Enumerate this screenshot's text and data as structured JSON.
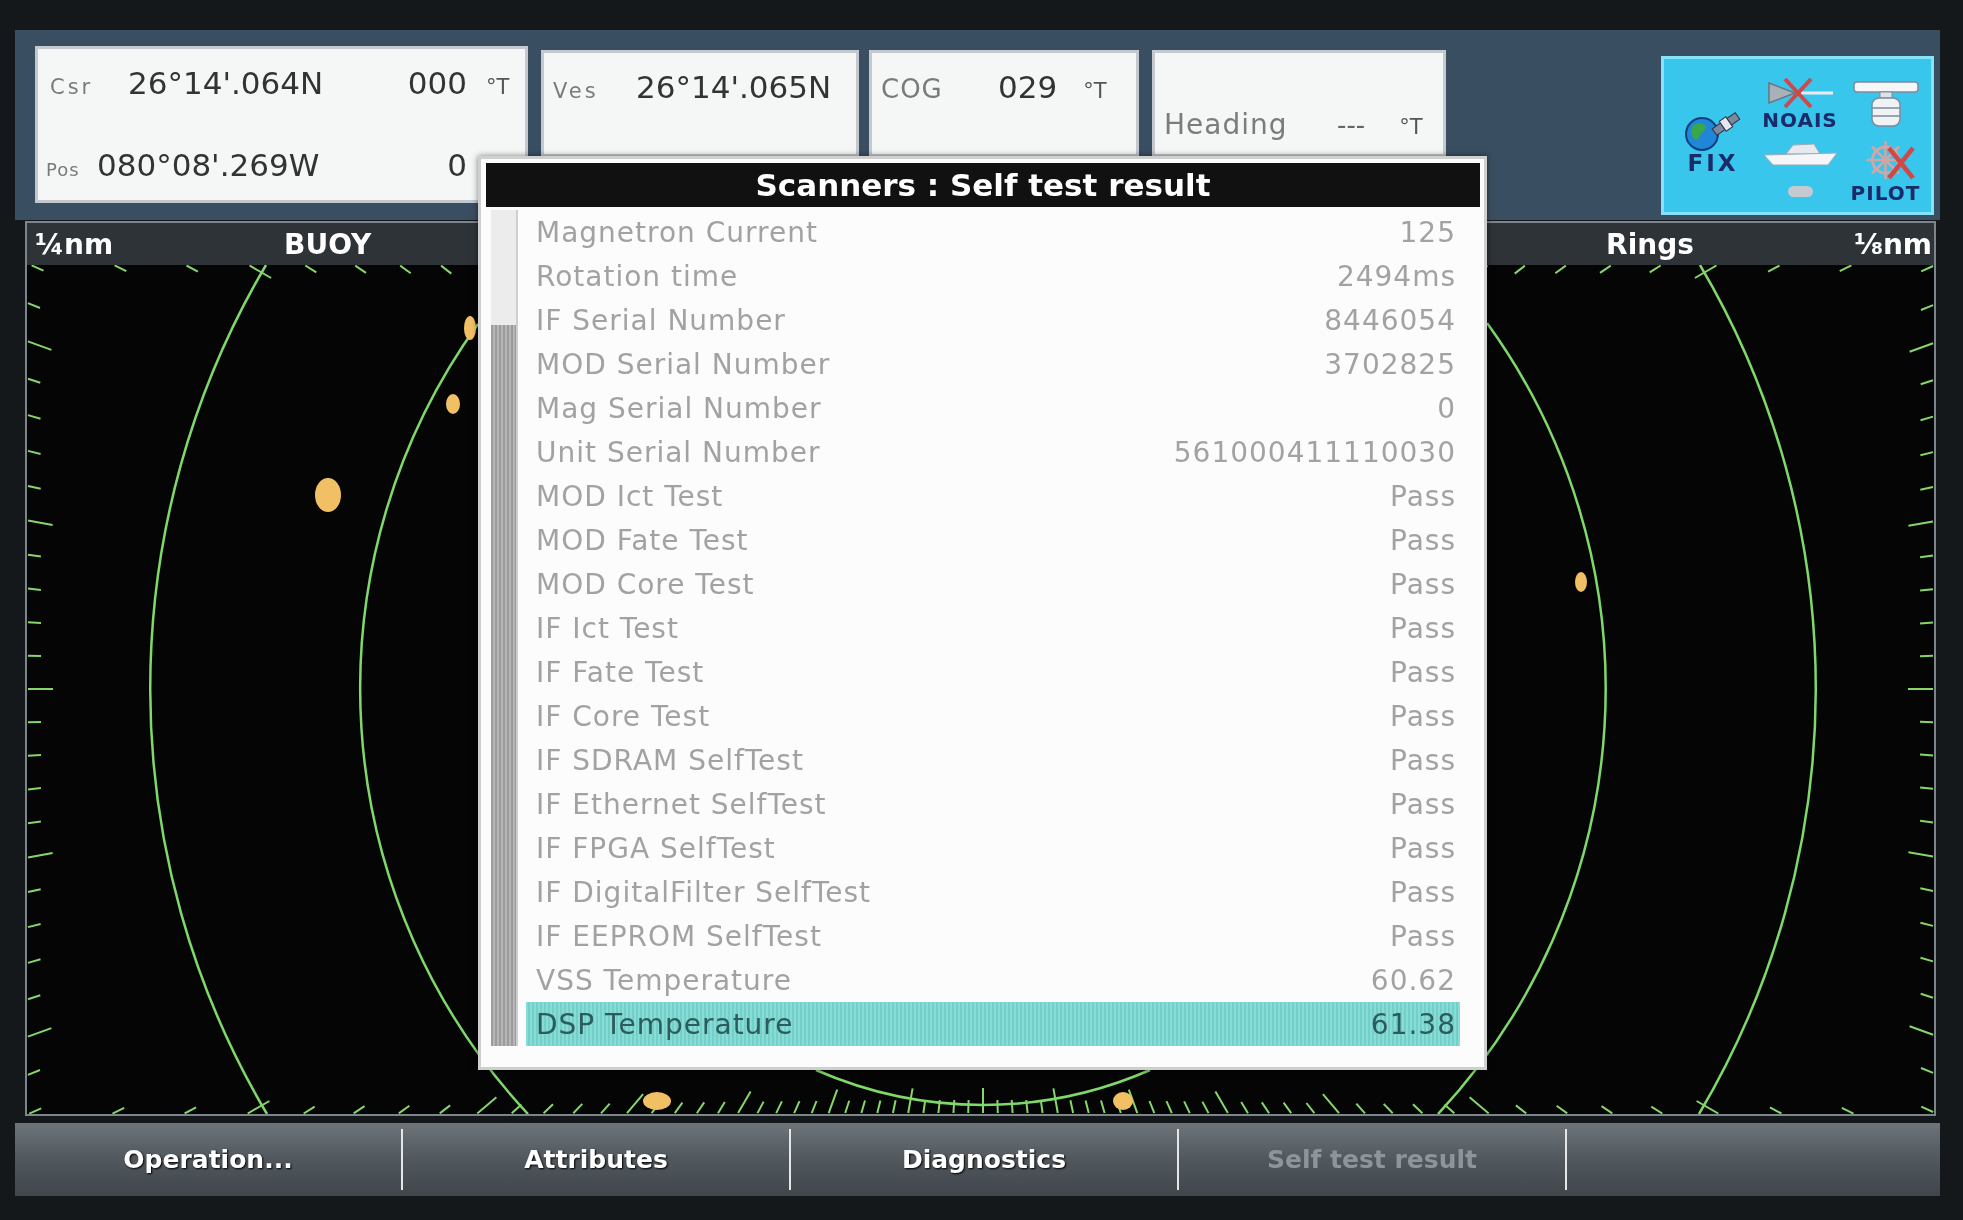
{
  "position_panel": {
    "cursor": {
      "label": "Csr",
      "latitude": "26°14'.064N",
      "bearing": "000",
      "unit": "°T"
    },
    "position": {
      "label": "Pos",
      "longitude": "080°08'.269W",
      "value": "0"
    }
  },
  "vessel_panel": {
    "label": "Ves",
    "latitude": "26°14'.065N"
  },
  "cog_panel": {
    "label": "COG",
    "value": "029",
    "unit": "°T"
  },
  "heading_panel": {
    "label": "Heading",
    "value": "---",
    "unit": "°T"
  },
  "status_panel": {
    "items": [
      {
        "kind": "satellite",
        "label": "FIX",
        "on": true
      },
      {
        "kind": "ais",
        "label": "NOAIS",
        "on": false
      },
      {
        "kind": "antenna",
        "on": true
      },
      {
        "kind": "boat",
        "on": true
      },
      {
        "kind": "capsule",
        "on": true
      },
      {
        "kind": "wheel",
        "label": "PILOT",
        "on": false
      }
    ]
  },
  "radar": {
    "range": "¼nm",
    "mode": "BUOY",
    "rings_label": "Rings",
    "rings_range": "⅛nm"
  },
  "dialog": {
    "title": "Scanners : Self test result",
    "rows": [
      {
        "label": "Magnetron Current",
        "value": "125",
        "selected": false
      },
      {
        "label": "Rotation time",
        "value": "2494ms",
        "selected": false
      },
      {
        "label": "IF Serial Number",
        "value": "8446054",
        "selected": false
      },
      {
        "label": "MOD Serial Number",
        "value": "3702825",
        "selected": false
      },
      {
        "label": "Mag Serial Number",
        "value": "0",
        "selected": false
      },
      {
        "label": "Unit Serial Number",
        "value": "561000411110030",
        "selected": false
      },
      {
        "label": "MOD Ict Test",
        "value": "Pass",
        "selected": false
      },
      {
        "label": "MOD Fate Test",
        "value": "Pass",
        "selected": false
      },
      {
        "label": "MOD Core Test",
        "value": "Pass",
        "selected": false
      },
      {
        "label": "IF Ict Test",
        "value": "Pass",
        "selected": false
      },
      {
        "label": "IF Fate Test",
        "value": "Pass",
        "selected": false
      },
      {
        "label": "IF Core Test",
        "value": "Pass",
        "selected": false
      },
      {
        "label": "IF SDRAM SelfTest",
        "value": "Pass",
        "selected": false
      },
      {
        "label": "IF Ethernet SelfTest",
        "value": "Pass",
        "selected": false
      },
      {
        "label": "IF FPGA SelfTest",
        "value": "Pass",
        "selected": false
      },
      {
        "label": "IF DigitalFilter SelfTest",
        "value": "Pass",
        "selected": false
      },
      {
        "label": "IF EEPROM SelfTest",
        "value": "Pass",
        "selected": false
      },
      {
        "label": "VSS Temperature",
        "value": "60.62",
        "selected": false
      },
      {
        "label": "DSP Temperature",
        "value": "61.38",
        "selected": true
      }
    ]
  },
  "softkeys": [
    {
      "label": "Operation...",
      "disabled": false
    },
    {
      "label": "Attributes",
      "disabled": false
    },
    {
      "label": "Diagnostics",
      "disabled": false
    },
    {
      "label": "Self test result",
      "disabled": true
    }
  ]
}
